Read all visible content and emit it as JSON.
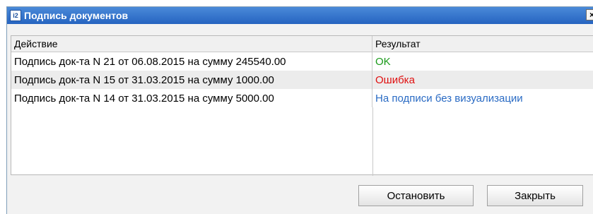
{
  "dialog": {
    "title": "Подпись документов",
    "app_icon_text": "i2",
    "close_symbol": "×"
  },
  "table": {
    "columns": [
      "Действие",
      "Результат"
    ],
    "rows": [
      {
        "action": "Подпись док-та N 21 от 06.08.2015 на сумму 245540.00",
        "result": "OK",
        "result_color": "#1a9a1a"
      },
      {
        "action": "Подпись док-та N 15 от 31.03.2015 на сумму 1000.00",
        "result": "Ошибка",
        "result_color": "#e01010"
      },
      {
        "action": "Подпись док-та N 14 от 31.03.2015 на сумму 5000.00",
        "result": "На подписи без визуализации",
        "result_color": "#2a6bc4"
      }
    ]
  },
  "buttons": {
    "stop_label": "Остановить",
    "close_label": "Закрыть"
  }
}
